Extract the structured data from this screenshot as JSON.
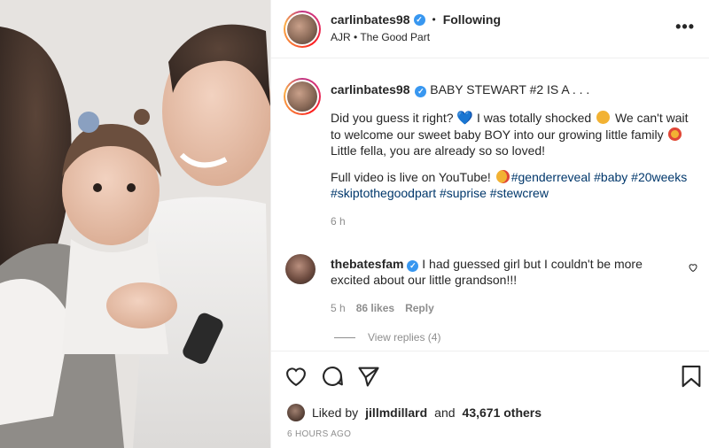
{
  "post": {
    "username": "carlinbates98",
    "separator": "•",
    "follow_status": "Following",
    "audio": "AJR • The Good Part",
    "more_label": "•••"
  },
  "caption": {
    "username": "carlinbates98",
    "headline": "BABY STEWART #2 IS A . . .",
    "line1_a": "Did you guess it right?",
    "line1_b": "I was totally shocked",
    "line1_c": "We can't wait to welcome our sweet baby BOY into our growing little family",
    "line1_d": "Little fella, you are already so so loved!",
    "line2_a": "Full video is live on YouTube!",
    "hashtags": [
      "#genderreveal",
      "#baby",
      "#20weeks",
      "#skiptothegoodpart",
      "#suprise",
      "#stewcrew"
    ],
    "time": "6 h"
  },
  "comment": {
    "username": "thebatesfam",
    "text": "I had guessed girl but I couldn't be more excited about our little grandson!!!",
    "time": "5 h",
    "likes": "86 likes",
    "reply_label": "Reply",
    "view_replies": "View replies (4)"
  },
  "footer": {
    "liked_by_prefix": "Liked by",
    "liked_by_user": "jillmdillard",
    "liked_by_and": "and",
    "liked_by_count": "43,671 others",
    "posted_ago": "6 HOURS AGO"
  },
  "icons": {
    "like": "heart-outline-icon",
    "comment": "comment-bubble-icon",
    "share": "paper-plane-icon",
    "save": "bookmark-icon",
    "verified": "verified-badge-icon"
  },
  "colors": {
    "verified": "#3897f0",
    "hashtag": "#00376b",
    "muted": "#8e8e8e",
    "text": "#262626"
  }
}
